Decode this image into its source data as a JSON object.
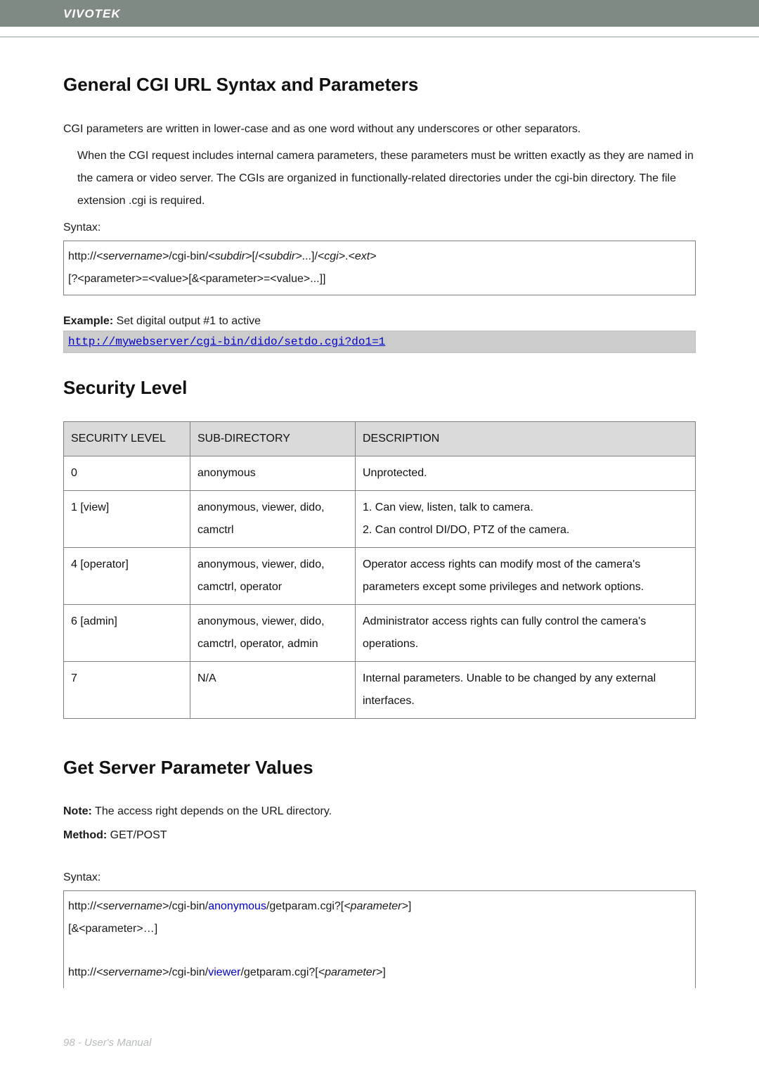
{
  "header": {
    "brand": "VIVOTEK"
  },
  "section1": {
    "heading": "General CGI URL Syntax and Parameters",
    "p1": "CGI parameters are written in lower-case and as one word without any underscores or other separators.",
    "p2": "When the CGI request includes internal camera parameters, these parameters must be written exactly as they are named in the camera or video server. The CGIs are organized in functionally-related directories under the cgi-bin directory. The file extension .cgi is required.",
    "syntax_label": "Syntax:",
    "syntax": {
      "prefix": "http://",
      "servername": "<servername>",
      "mid1": "/cgi-bin/",
      "subdir1": "<subdir>",
      "mid2": "[/",
      "subdir2": "<subdir>",
      "mid3": "...]/",
      "cgi": "<cgi>",
      "dot": ".",
      "ext": "<ext>",
      "line2": "[?<parameter>=<value>[&<parameter>=<value>...]]"
    },
    "example_label": "Example:",
    "example_desc": " Set digital output #1 to active",
    "example_url": "http://mywebserver/cgi-bin/dido/setdo.cgi?do1=1"
  },
  "section2": {
    "heading": "Security Level",
    "headers": {
      "c1": "SECURITY LEVEL",
      "c2": "SUB-DIRECTORY",
      "c3": "DESCRIPTION"
    },
    "rows": [
      {
        "level": "0",
        "subdir": "anonymous",
        "desc": "Unprotected."
      },
      {
        "level": "1 [view]",
        "subdir": "anonymous, viewer, dido, camctrl",
        "desc": "1. Can view, listen, talk to camera.\n2. Can control DI/DO, PTZ of the camera."
      },
      {
        "level": "4 [operator]",
        "subdir": "anonymous, viewer, dido, camctrl, operator",
        "desc": "Operator access rights can modify most of the camera's parameters except some privileges and network options."
      },
      {
        "level": "6 [admin]",
        "subdir": "anonymous, viewer, dido, camctrl, operator, admin",
        "desc": "Administrator access rights can fully control the camera's operations."
      },
      {
        "level": "7",
        "subdir": "N/A",
        "desc": "Internal parameters. Unable to be changed by any external interfaces."
      }
    ]
  },
  "section3": {
    "heading": "Get Server Parameter Values",
    "note_label": "Note:",
    "note_text": " The access right depends on the URL directory.",
    "method_label": "Method:",
    "method_text": " GET/POST",
    "syntax_label": "Syntax:",
    "box": {
      "r1": {
        "pre": "http://",
        "srv": "<servername>",
        "mid": "/cgi-bin/",
        "dir": "anonymous",
        "post": "/getparam.cgi?[",
        "param": "<parameter>",
        "end": "]"
      },
      "r2": "[&<parameter>…]",
      "r3": {
        "pre": "http://",
        "srv": "<servername>",
        "mid": "/cgi-bin/",
        "dir": "viewer",
        "post": "/getparam.cgi?[",
        "param": "<parameter>",
        "end": "]"
      }
    }
  },
  "footer": {
    "text": "98 - User's Manual"
  }
}
